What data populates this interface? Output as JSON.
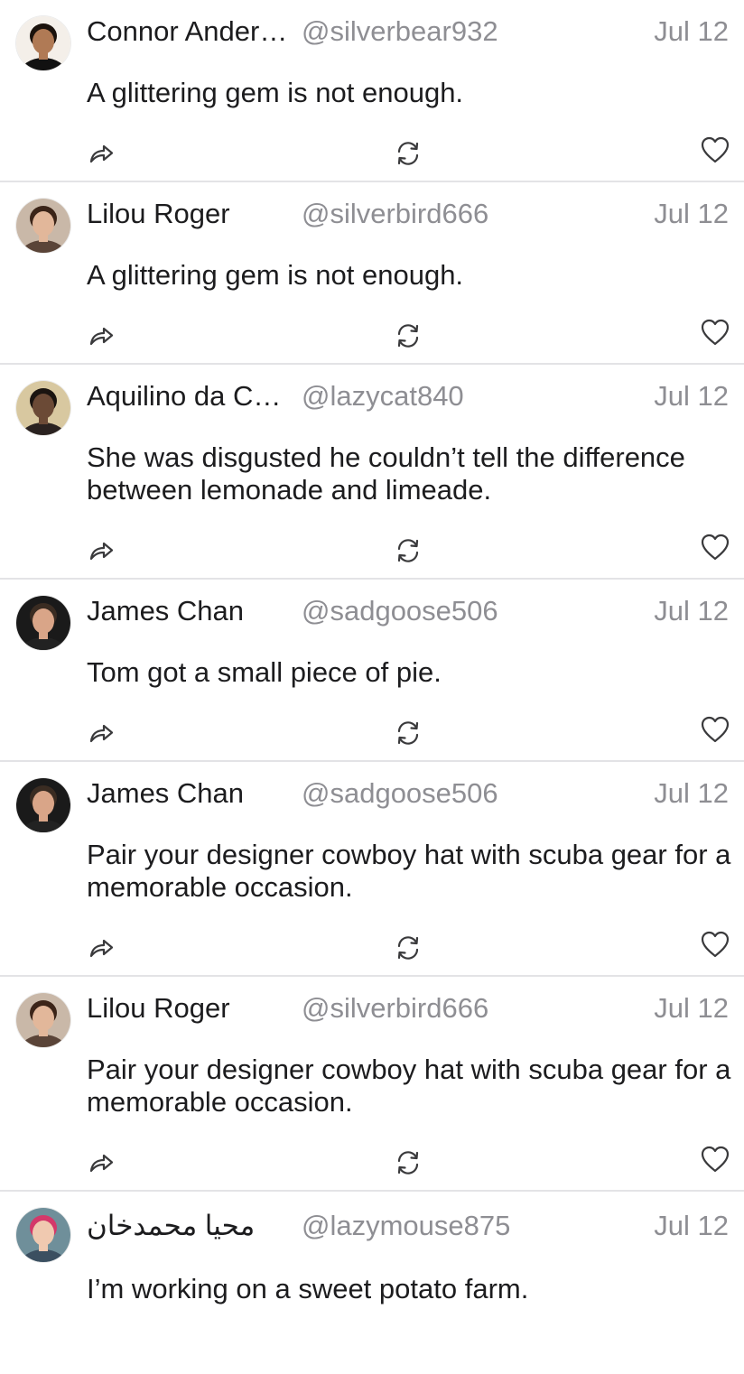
{
  "theme": {
    "text": "#1c1c1e",
    "secondary": "#8e8e93",
    "divider": "#e3e3e6",
    "icon": "#3a3a3c"
  },
  "actions": {
    "share_icon": "share-arrow-icon",
    "repost_icon": "repost-icon",
    "like_icon": "heart-icon"
  },
  "posts": [
    {
      "author": "Connor Anderson",
      "handle": "@silverbear932",
      "date": "Jul 12",
      "text": "A glittering gem is not enough.",
      "avatar": {
        "skin": "#b07a55",
        "hair": "#1b120c",
        "bg": "#f4efe9",
        "shirt": "#111111"
      }
    },
    {
      "author": "Lilou Roger",
      "handle": "@silverbird666",
      "date": "Jul 12",
      "text": "A glittering gem is not enough.",
      "avatar": {
        "skin": "#e2b79a",
        "hair": "#3b2418",
        "bg": "#c9b8a8",
        "shirt": "#5a4438"
      }
    },
    {
      "author": "Aquilino da Cunha",
      "handle": "@lazycat840",
      "date": "Jul 12",
      "text": "She was disgusted he couldn’t tell the difference between lemonade and limeade.",
      "avatar": {
        "skin": "#6b4a36",
        "hair": "#1a1410",
        "bg": "#d8c8a0",
        "shirt": "#2a2220"
      }
    },
    {
      "author": "James Chan",
      "handle": "@sadgoose506",
      "date": "Jul 12",
      "text": "Tom got a small piece of pie.",
      "avatar": {
        "skin": "#d9a588",
        "hair": "#3a2c22",
        "bg": "#1a1a1a",
        "shirt": "#222222"
      }
    },
    {
      "author": "James Chan",
      "handle": "@sadgoose506",
      "date": "Jul 12",
      "text": "Pair your designer cowboy hat with scuba gear for a memorable occasion.",
      "avatar": {
        "skin": "#d9a588",
        "hair": "#3a2c22",
        "bg": "#1a1a1a",
        "shirt": "#222222"
      }
    },
    {
      "author": "Lilou Roger",
      "handle": "@silverbird666",
      "date": "Jul 12",
      "text": "Pair your designer cowboy hat with scuba gear for a memorable occasion.",
      "avatar": {
        "skin": "#e2b79a",
        "hair": "#3b2418",
        "bg": "#c9b8a8",
        "shirt": "#5a4438"
      }
    },
    {
      "author": "محيا محمدخان",
      "handle": "@lazymouse875",
      "date": "Jul 12",
      "text": "I’m working on a sweet potato farm.",
      "avatar": {
        "skin": "#f0c9b0",
        "hair": "#d4386a",
        "bg": "#6f8f9a",
        "shirt": "#3b4f60"
      }
    }
  ]
}
